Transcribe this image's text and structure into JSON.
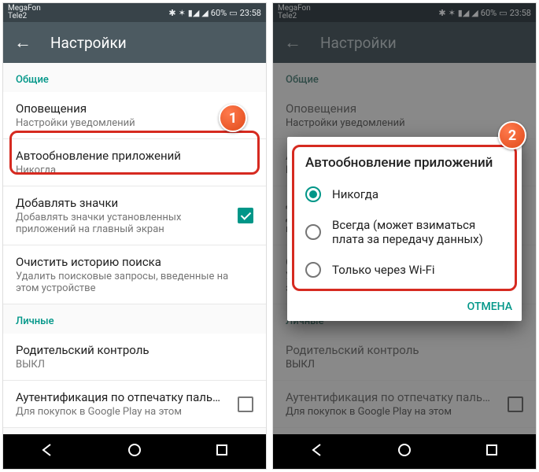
{
  "status": {
    "carrier1": "MegaFon",
    "carrier2": "Tele2",
    "battery": "60%",
    "time": "23:58"
  },
  "appbar": {
    "title": "Настройки"
  },
  "sections": {
    "general": "Общие",
    "personal": "Личные"
  },
  "rows": {
    "notifications": {
      "title": "Оповещения",
      "sub": "Настройки уведомлений"
    },
    "autoupdate": {
      "title": "Автообновление приложений",
      "sub": "Никогда"
    },
    "addIcons": {
      "title": "Добавлять значки",
      "sub": "Добавлять значки установленных приложений на главный экран"
    },
    "clearSearch": {
      "title": "Очистить историю поиска",
      "sub": "Удалить поисковые запросы, введенные на этом устройстве"
    },
    "parental": {
      "title": "Родительский контроль",
      "sub": "ВЫКЛ"
    },
    "fingerprint": {
      "title": "Аутентификация по отпечатку паль…",
      "sub": "Для покупок в Google Play на этом"
    }
  },
  "dialog": {
    "title": "Автообновление приложений",
    "options": [
      "Никогда",
      "Всегда (может взиматься плата за передачу данных)",
      "Только через Wi-Fi"
    ],
    "cancel": "ОТМЕНА"
  },
  "callouts": {
    "one": "1",
    "two": "2"
  }
}
